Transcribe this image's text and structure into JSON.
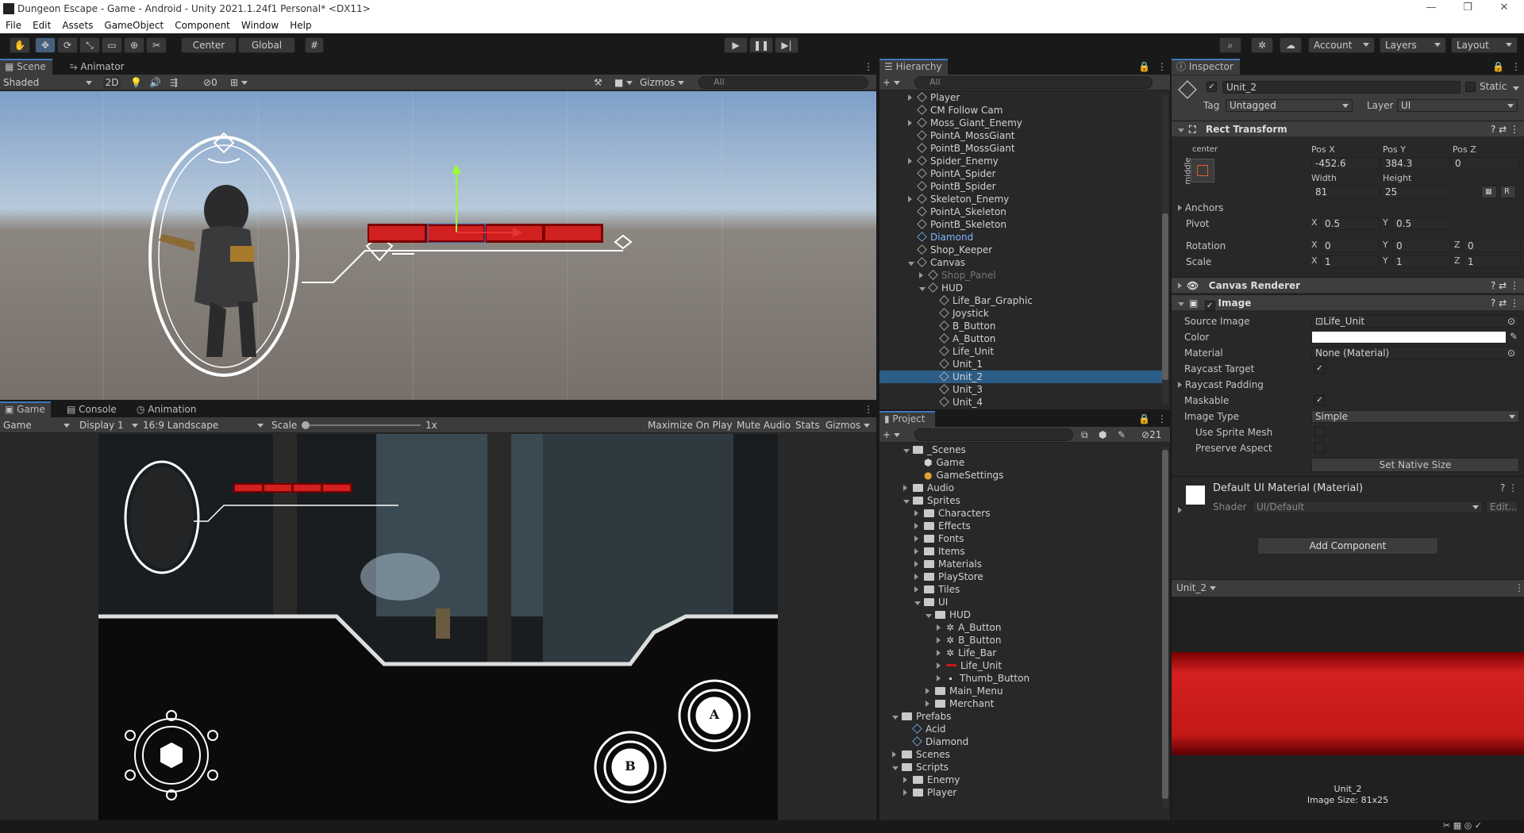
{
  "window": {
    "title": "Dungeon Escape - Game - Android - Unity 2021.1.24f1 Personal* <DX11>",
    "min": "—",
    "max": "❐",
    "close": "✕"
  },
  "menu": [
    "File",
    "Edit",
    "Assets",
    "GameObject",
    "Component",
    "Window",
    "Help"
  ],
  "toolbar": {
    "center": "Center",
    "global": "Global",
    "account": "Account",
    "layers": "Layers",
    "layout": "Layout"
  },
  "scene": {
    "tabs": [
      "Scene",
      "Animator"
    ],
    "shading": "Shaded",
    "mode2d": "2D",
    "hidden_count": "0",
    "gizmos": "Gizmos",
    "search_placeholder": "All"
  },
  "game": {
    "tabs": [
      "Game",
      "Console",
      "Animation"
    ],
    "view": "Game",
    "display": "Display 1",
    "aspect": "16:9 Landscape",
    "scale_label": "Scale",
    "scale_value": "1x",
    "buttons": [
      "Maximize On Play",
      "Mute Audio",
      "Stats",
      "Gizmos"
    ],
    "btn_a": "A",
    "btn_b": "B"
  },
  "hierarchy": {
    "title": "Hierarchy",
    "search_placeholder": "All",
    "items": [
      {
        "label": "Player",
        "indent": 0,
        "arrow": "right"
      },
      {
        "label": "CM Follow Cam",
        "indent": 0,
        "arrow": ""
      },
      {
        "label": "Moss_Giant_Enemy",
        "indent": 0,
        "arrow": "right"
      },
      {
        "label": "PointA_MossGiant",
        "indent": 0,
        "arrow": ""
      },
      {
        "label": "PointB_MossGiant",
        "indent": 0,
        "arrow": ""
      },
      {
        "label": "Spider_Enemy",
        "indent": 0,
        "arrow": "right"
      },
      {
        "label": "PointA_Spider",
        "indent": 0,
        "arrow": ""
      },
      {
        "label": "PointB_Spider",
        "indent": 0,
        "arrow": ""
      },
      {
        "label": "Skeleton_Enemy",
        "indent": 0,
        "arrow": "right"
      },
      {
        "label": "PointA_Skeleton",
        "indent": 0,
        "arrow": ""
      },
      {
        "label": "PointB_Skeleton",
        "indent": 0,
        "arrow": ""
      },
      {
        "label": "Diamond",
        "indent": 0,
        "arrow": "",
        "prefab": true
      },
      {
        "label": "Shop_Keeper",
        "indent": 0,
        "arrow": ""
      },
      {
        "label": "Canvas",
        "indent": 0,
        "arrow": "down"
      },
      {
        "label": "Shop_Panel",
        "indent": 1,
        "arrow": "right",
        "dim": true
      },
      {
        "label": "HUD",
        "indent": 1,
        "arrow": "down"
      },
      {
        "label": "Life_Bar_Graphic",
        "indent": 2,
        "arrow": ""
      },
      {
        "label": "Joystick",
        "indent": 2,
        "arrow": ""
      },
      {
        "label": "B_Button",
        "indent": 2,
        "arrow": ""
      },
      {
        "label": "A_Button",
        "indent": 2,
        "arrow": ""
      },
      {
        "label": "Life_Unit",
        "indent": 2,
        "arrow": ""
      },
      {
        "label": "Unit_1",
        "indent": 2,
        "arrow": ""
      },
      {
        "label": "Unit_2",
        "indent": 2,
        "arrow": "",
        "selected": true
      },
      {
        "label": "Unit_3",
        "indent": 2,
        "arrow": ""
      },
      {
        "label": "Unit_4",
        "indent": 2,
        "arrow": ""
      }
    ]
  },
  "project": {
    "title": "Project",
    "hidden_count": "21",
    "items": [
      {
        "label": "_Scenes",
        "indent": 1,
        "type": "folder",
        "arrow": "down"
      },
      {
        "label": "Game",
        "indent": 2,
        "type": "scene",
        "arrow": ""
      },
      {
        "label": "GameSettings",
        "indent": 2,
        "type": "settings",
        "arrow": ""
      },
      {
        "label": "Audio",
        "indent": 1,
        "type": "folder",
        "arrow": "right"
      },
      {
        "label": "Sprites",
        "indent": 1,
        "type": "folder",
        "arrow": "down"
      },
      {
        "label": "Characters",
        "indent": 2,
        "type": "folder",
        "arrow": "right"
      },
      {
        "label": "Effects",
        "indent": 2,
        "type": "folder",
        "arrow": "right"
      },
      {
        "label": "Fonts",
        "indent": 2,
        "type": "folder",
        "arrow": "right"
      },
      {
        "label": "Items",
        "indent": 2,
        "type": "folder",
        "arrow": "right"
      },
      {
        "label": "Materials",
        "indent": 2,
        "type": "folder",
        "arrow": "right"
      },
      {
        "label": "PlayStore",
        "indent": 2,
        "type": "folder",
        "arrow": "right"
      },
      {
        "label": "Tiles",
        "indent": 2,
        "type": "folder",
        "arrow": "right"
      },
      {
        "label": "UI",
        "indent": 2,
        "type": "folder",
        "arrow": "down"
      },
      {
        "label": "HUD",
        "indent": 3,
        "type": "folder",
        "arrow": "down"
      },
      {
        "label": "A_Button",
        "indent": 4,
        "type": "sprite",
        "arrow": "right"
      },
      {
        "label": "B_Button",
        "indent": 4,
        "type": "sprite",
        "arrow": "right"
      },
      {
        "label": "Life_Bar",
        "indent": 4,
        "type": "sprite",
        "arrow": "right"
      },
      {
        "label": "Life_Unit",
        "indent": 4,
        "type": "redsprite",
        "arrow": "right"
      },
      {
        "label": "Thumb_Button",
        "indent": 4,
        "type": "dot",
        "arrow": "right"
      },
      {
        "label": "Main_Menu",
        "indent": 3,
        "type": "folder",
        "arrow": "right"
      },
      {
        "label": "Merchant",
        "indent": 3,
        "type": "folder",
        "arrow": "right"
      },
      {
        "label": "Prefabs",
        "indent": 0,
        "type": "folder",
        "arrow": "down"
      },
      {
        "label": "Acid",
        "indent": 1,
        "type": "prefab",
        "arrow": ""
      },
      {
        "label": "Diamond",
        "indent": 1,
        "type": "prefab",
        "arrow": ""
      },
      {
        "label": "Scenes",
        "indent": 0,
        "type": "folder",
        "arrow": "right"
      },
      {
        "label": "Scripts",
        "indent": 0,
        "type": "folder",
        "arrow": "down"
      },
      {
        "label": "Enemy",
        "indent": 1,
        "type": "folder",
        "arrow": "right"
      },
      {
        "label": "Player",
        "indent": 1,
        "type": "folder",
        "arrow": "right"
      }
    ]
  },
  "inspector": {
    "title": "Inspector",
    "object_name": "Unit_2",
    "static_label": "Static",
    "tag_label": "Tag",
    "tag_value": "Untagged",
    "layer_label": "Layer",
    "layer_value": "UI",
    "rect": {
      "title": "Rect Transform",
      "anchor_h": "center",
      "anchor_v": "middle",
      "posx_label": "Pos X",
      "posy_label": "Pos Y",
      "posz_label": "Pos Z",
      "posx": "-452.6",
      "posy": "384.3",
      "posz": "0",
      "width_label": "Width",
      "height_label": "Height",
      "width": "81",
      "height": "25",
      "raw_btn": "R",
      "anchors": "Anchors",
      "pivot": "Pivot",
      "pivot_x": "0.5",
      "pivot_y": "0.5",
      "rotation": "Rotation",
      "rot_x": "0",
      "rot_y": "0",
      "rot_z": "0",
      "scale": "Scale",
      "scale_x": "1",
      "scale_y": "1",
      "scale_z": "1",
      "x": "X",
      "y": "Y",
      "z": "Z"
    },
    "canvas_renderer": "Canvas Renderer",
    "image": {
      "title": "Image",
      "source_label": "Source Image",
      "source": "Life_Unit",
      "color_label": "Color",
      "material_label": "Material",
      "material": "None (Material)",
      "raycast_label": "Raycast Target",
      "raycast_padding": "Raycast Padding",
      "maskable_label": "Maskable",
      "type_label": "Image Type",
      "type": "Simple",
      "sprite_mesh": "Use Sprite Mesh",
      "preserve": "Preserve Aspect",
      "native": "Set Native Size"
    },
    "material": {
      "title": "Default UI Material (Material)",
      "shader_label": "Shader",
      "shader": "UI/Default",
      "edit": "Edit..."
    },
    "add_component": "Add Component",
    "preview": {
      "dropdown": "Unit_2",
      "name": "Unit_2",
      "size": "Image Size: 81x25"
    }
  },
  "colors": {
    "accent": "#3a79bb",
    "selected_row": "#2c5d87",
    "lifebar": "#c41818",
    "prefab_text": "#7fb4ff"
  }
}
